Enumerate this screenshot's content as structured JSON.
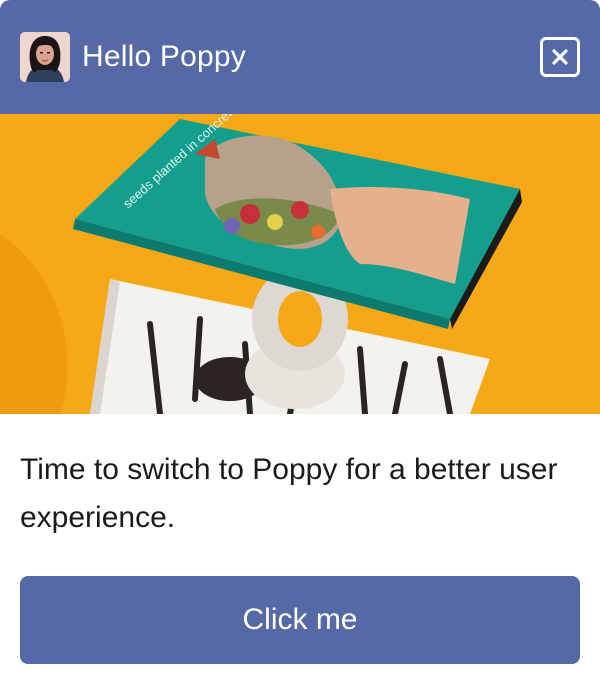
{
  "header": {
    "title": "Hello Poppy",
    "avatar_icon": "user-avatar",
    "close_icon": "close-icon"
  },
  "hero": {
    "cover_text": "seeds planted in concrete"
  },
  "body": {
    "message": "Time to switch to Poppy for a better user experience."
  },
  "cta": {
    "label": "Click me"
  },
  "colors": {
    "brand": "#5569a7",
    "hero_background": "#f7a816",
    "book_teal": "#139e8e",
    "text": "#1b1b1b"
  }
}
